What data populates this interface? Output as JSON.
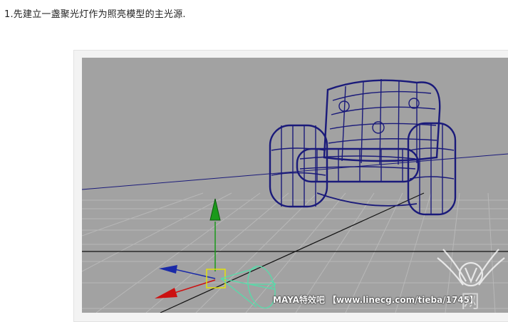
{
  "article": {
    "instruction": "1.先建立一盏聚光灯作为照亮模型的主光源."
  },
  "viewport": {
    "background": "#a2a2a2",
    "grid_color": "#b8b8b8",
    "wire_color": "#1a1a7a",
    "axis_colors": {
      "x": "#cc1111",
      "y": "#1a9a1a",
      "z": "#1a2aa8"
    },
    "spotlight_color": "#55ddaa",
    "selection_color": "#e8e800"
  },
  "watermark": {
    "text": "MAYA特效吧 【www.linecg.com/tieba/1745】"
  },
  "logo": {
    "icon": "wings-v-logo-icon",
    "text": "网"
  }
}
